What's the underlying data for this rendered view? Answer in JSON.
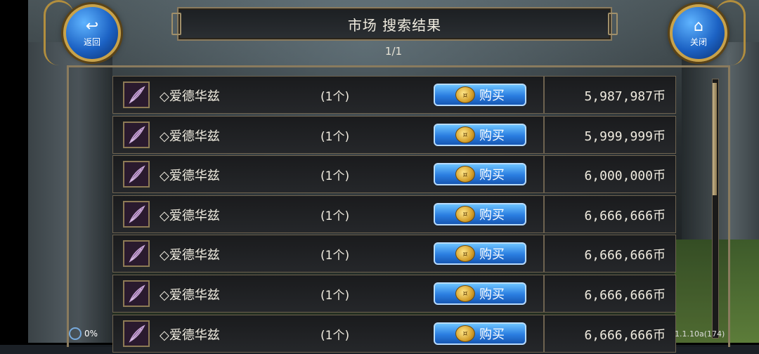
{
  "header": {
    "title": "市场 搜索结果",
    "page_indicator": "1/1"
  },
  "nav": {
    "back": {
      "label": "返回",
      "icon": "return-arrow-icon"
    },
    "close": {
      "label": "关闭",
      "icon": "home-icon"
    }
  },
  "listings": [
    {
      "name": "◇爱德华兹",
      "qty": "(1个)",
      "buy_label": "购买",
      "price": "5,987,987币"
    },
    {
      "name": "◇爱德华兹",
      "qty": "(1个)",
      "buy_label": "购买",
      "price": "5,999,999币"
    },
    {
      "name": "◇爱德华兹",
      "qty": "(1个)",
      "buy_label": "购买",
      "price": "6,000,000币"
    },
    {
      "name": "◇爱德华兹",
      "qty": "(1个)",
      "buy_label": "购买",
      "price": "6,666,666币"
    },
    {
      "name": "◇爱德华兹",
      "qty": "(1个)",
      "buy_label": "购买",
      "price": "6,666,666币"
    },
    {
      "name": "◇爱德华兹",
      "qty": "(1个)",
      "buy_label": "购买",
      "price": "6,666,666币"
    },
    {
      "name": "◇爱德华兹",
      "qty": "(1个)",
      "buy_label": "购买",
      "price": "6,666,666币"
    }
  ],
  "status": {
    "progress": "0%",
    "version": "1.1.10a(174)"
  },
  "colors": {
    "frame_gold": "#8a7b5e",
    "button_blue": "#2a7de0",
    "row_bg": "#1a1b1d"
  }
}
